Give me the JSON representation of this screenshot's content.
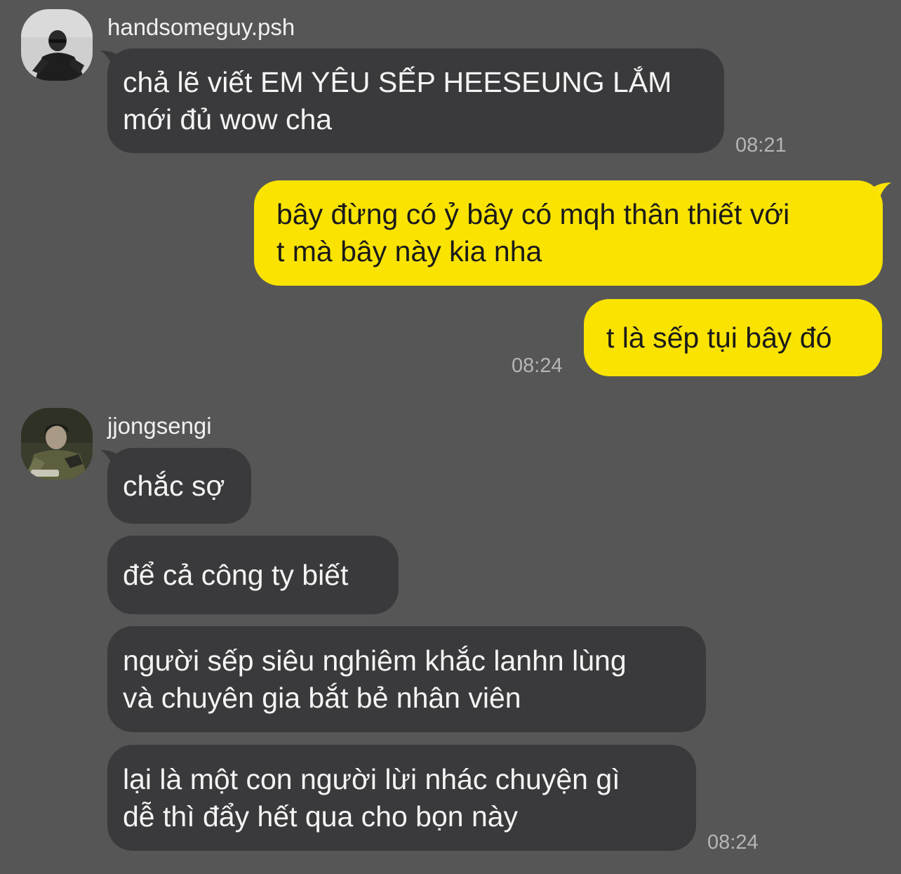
{
  "colors": {
    "background": "#575657",
    "incoming_bubble": "#3a393b",
    "outgoing_bubble": "#fbe300",
    "timestamp": "#b5b4b6"
  },
  "messages": {
    "group1": {
      "sender": "handsomeguy.psh",
      "avatar_icon": "user-avatar-photo",
      "bubble1": "chả lẽ viết EM YÊU SẾP HEESEUNG LẮM\nmới đủ wow cha",
      "time": "08:21"
    },
    "group2": {
      "bubble1": "bây đừng có ỷ bây có mqh thân thiết với\nt mà bây này kia nha",
      "bubble2": "t là sếp tụi bây đó",
      "time": "08:24"
    },
    "group3": {
      "sender": "jjongsengi",
      "avatar_icon": "user-avatar-photo",
      "bubble1": "chắc sợ",
      "bubble2": "để cả công ty biết",
      "bubble3": "người sếp siêu nghiêm khắc lanhn lùng\nvà chuyên gia bắt bẻ nhân viên",
      "bubble4": "lại là một con người lừi nhác chuyện gì\ndễ thì đẩy hết qua cho bọn này",
      "time": "08:24"
    }
  }
}
